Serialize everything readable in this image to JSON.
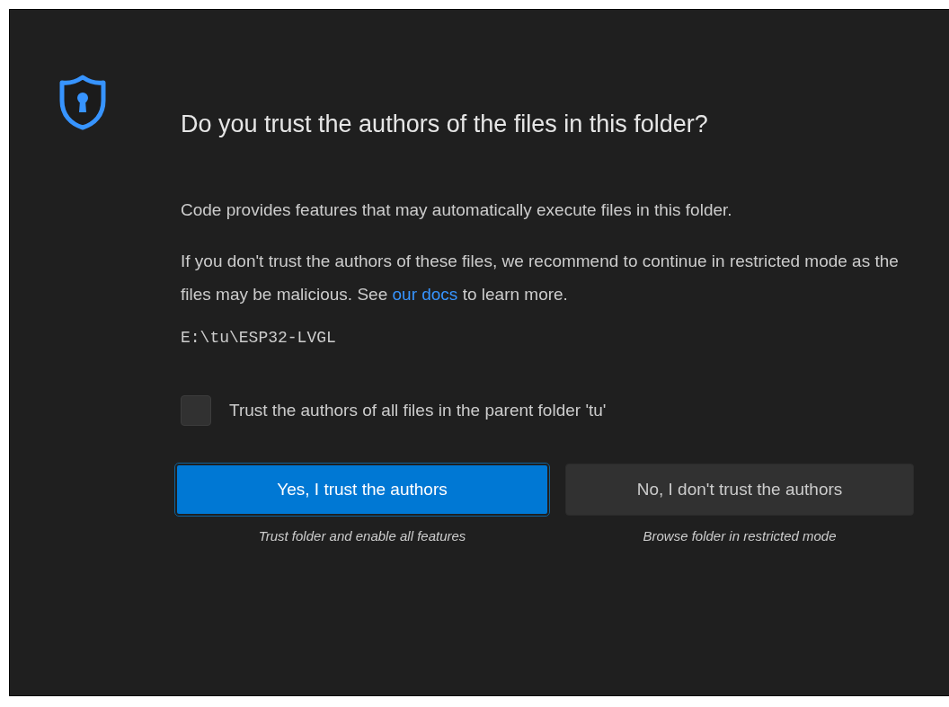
{
  "dialog": {
    "title": "Do you trust the authors of the files in this folder?",
    "paragraphs": [
      {
        "text": "Code provides features that may automatically execute files in this folder."
      },
      {
        "text": "If you don't trust the authors of these files, we recommend to continue in restricted mode as the files may be malicious. See ",
        "link": "our docs",
        "after": " to learn more."
      }
    ],
    "path": "E:\\tu\\ESP32-LVGL",
    "checkbox": {
      "label": "Trust the authors of all files in the parent folder 'tu'",
      "checked": false
    },
    "buttons": [
      {
        "label": "Yes, I trust the authors",
        "kind": "primary",
        "caption": "Trust folder and enable all features"
      },
      {
        "label": "No, I don't trust the authors",
        "kind": "secondary",
        "caption": "Browse folder in restricted mode"
      }
    ]
  }
}
